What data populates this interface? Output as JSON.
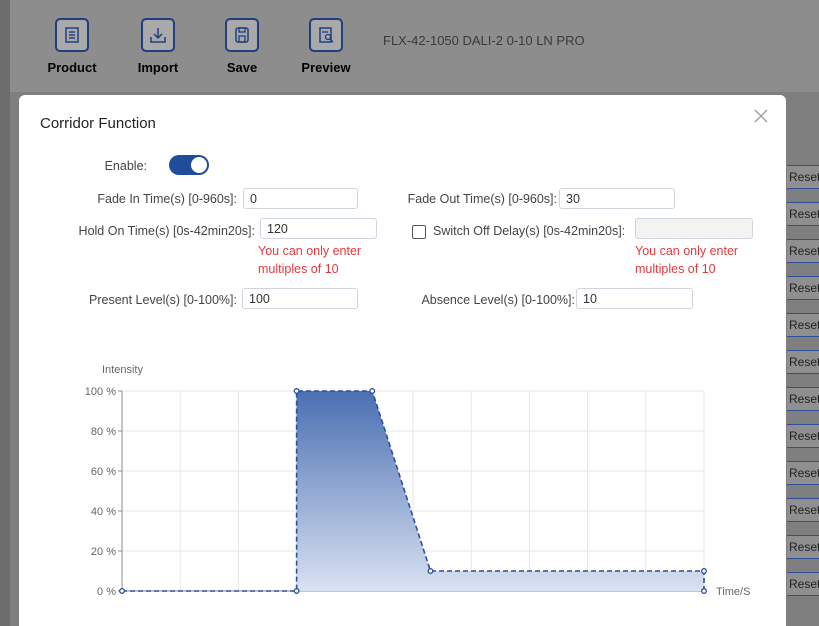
{
  "toolbar": {
    "items": [
      {
        "label": "Product",
        "icon": "document-icon"
      },
      {
        "label": "Import",
        "icon": "download-icon"
      },
      {
        "label": "Save",
        "icon": "save-icon"
      },
      {
        "label": "Preview",
        "icon": "preview-icon"
      }
    ],
    "device_title": "FLX-42-1050 DALI-2 0-10 LN PRO"
  },
  "side_buttons": {
    "label": "Reset",
    "count": 13
  },
  "modal": {
    "title": "Corridor Function",
    "enable_label": "Enable:",
    "enable_on": true,
    "fade_in_label": "Fade In Time(s) [0-960s]:",
    "fade_in_value": "0",
    "fade_out_label": "Fade Out Time(s) [0-960s]:",
    "fade_out_value": "30",
    "hold_on_label": "Hold On Time(s) [0s-42min20s]:",
    "hold_on_value": "120",
    "hold_on_error_line1": "You can only enter",
    "hold_on_error_line2": "multiples of 10",
    "switch_off_label": "Switch Off Delay(s) [0s-42min20s]:",
    "switch_off_value": "",
    "switch_off_checked": false,
    "switch_off_error_line1": "You can only enter",
    "switch_off_error_line2": "multiples of 10",
    "present_label": "Present Level(s) [0-100%]:",
    "present_value": "100",
    "absence_label": "Absence Level(s) [0-100%]:",
    "absence_value": "10"
  },
  "chart_data": {
    "type": "area",
    "ylabel": "Intensity",
    "xlabel": "Time/S",
    "y_ticks": [
      "0 %",
      "20 %",
      "40 %",
      "60 %",
      "80 %",
      "100 %"
    ],
    "ylim": [
      0,
      100
    ],
    "xlim": [
      0,
      10
    ],
    "x": [
      0,
      3,
      3,
      4.3,
      5.3,
      10,
      10
    ],
    "y": [
      0,
      0,
      100,
      100,
      10,
      10,
      0
    ],
    "grid": true,
    "colors": {
      "line": "#2a4f9e",
      "fill_top": "#4a6fb3",
      "fill_bottom": "#d9e2f1"
    }
  }
}
